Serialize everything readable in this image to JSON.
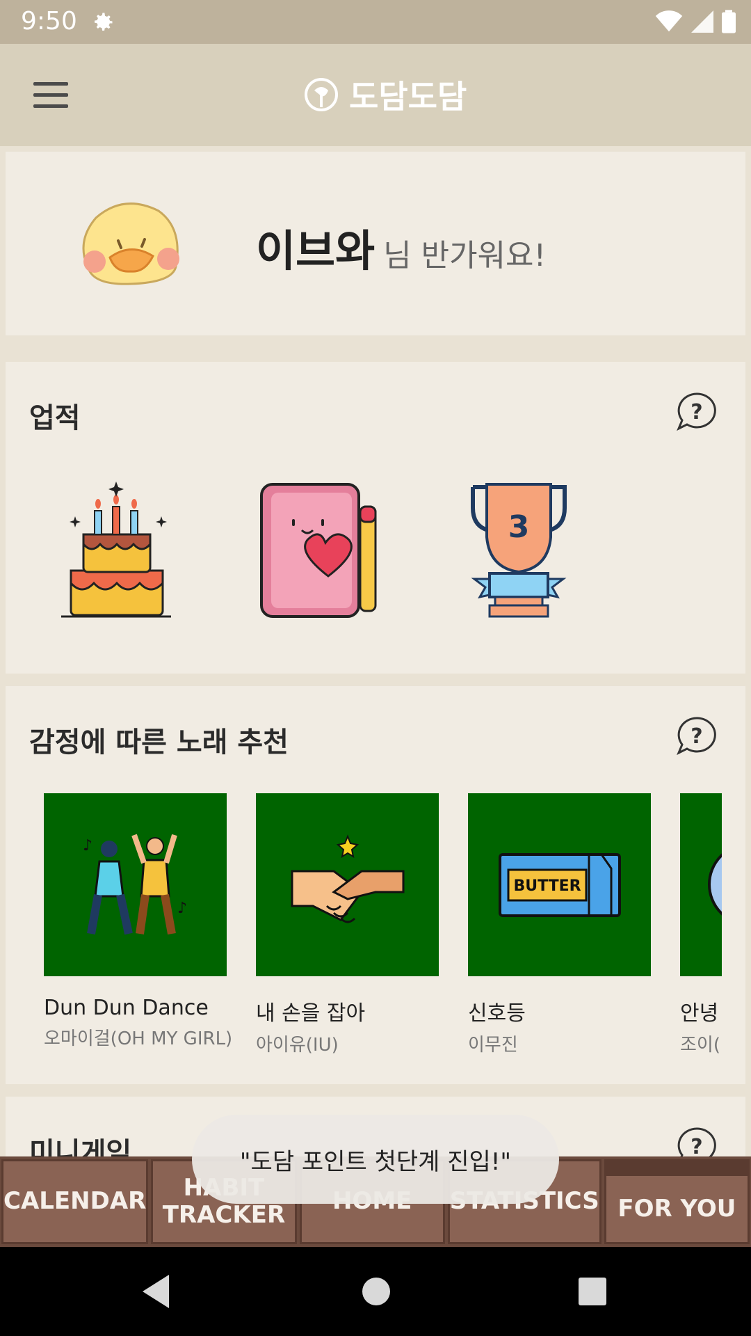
{
  "status_bar": {
    "time": "9:50"
  },
  "app_bar": {
    "title": "도담도담"
  },
  "greeting": {
    "name": "이브와",
    "message": "님 반가워요!"
  },
  "achievements": {
    "title": "업적",
    "badges": [
      {
        "icon": "birthday-cake-icon"
      },
      {
        "icon": "diary-heart-icon"
      },
      {
        "icon": "trophy-3-icon",
        "number": "3"
      }
    ]
  },
  "music": {
    "title": "감정에 따른 노래 추천",
    "songs": [
      {
        "title": "Dun Dun Dance",
        "artist": "오마이걸(OH MY GIRL)",
        "icon": "dancing-people-icon"
      },
      {
        "title": "내 손을 잡아",
        "artist": "아이유(IU)",
        "icon": "handshake-icon"
      },
      {
        "title": "신호등",
        "artist": "이무진",
        "icon": "butter-icon",
        "art_text": "BUTTER"
      },
      {
        "title": "안녕",
        "artist": "조이(...",
        "icon": "partial-art-icon"
      }
    ]
  },
  "minigame": {
    "title": "미니게임"
  },
  "tabs": [
    {
      "label": "CALENDAR"
    },
    {
      "label": "HABIT TRACKER"
    },
    {
      "label": "HOME"
    },
    {
      "label": "STATISTICS"
    },
    {
      "label": "FOR YOU",
      "active": true
    }
  ],
  "toast": {
    "text": "\"도담 포인트 첫단계 진입!\""
  },
  "colors": {
    "status_bar": "#beb29c",
    "app_bar": "#d8d0bc",
    "card": "#f1ece3",
    "album_bg": "#006400",
    "tab_bg": "#8a6354"
  }
}
